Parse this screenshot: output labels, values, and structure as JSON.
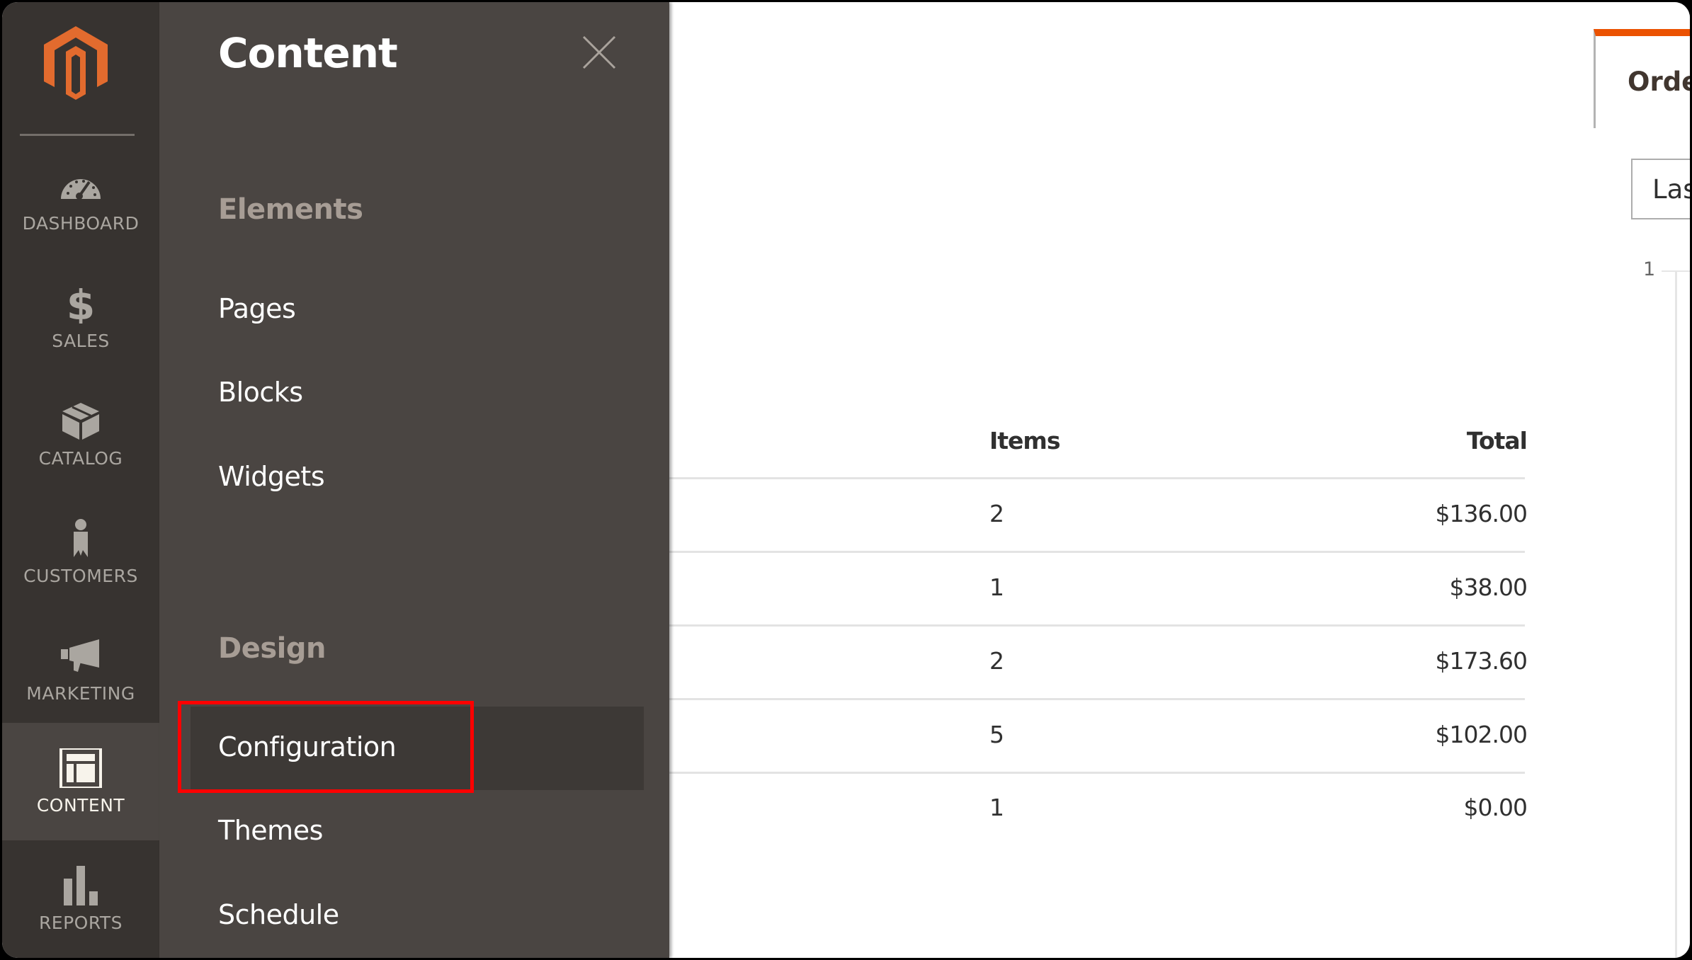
{
  "colors": {
    "brand_orange": "#eb5202",
    "nav_bg": "#373330",
    "flyout_bg": "#4a4542",
    "highlight_outline": "#ff0000"
  },
  "logo": {
    "icon": "magento-logo-icon"
  },
  "nav": {
    "items": [
      {
        "label": "DASHBOARD",
        "icon": "dashboard-gauge-icon",
        "active": false
      },
      {
        "label": "SALES",
        "icon": "dollar-icon",
        "active": false
      },
      {
        "label": "CATALOG",
        "icon": "box-icon",
        "active": false
      },
      {
        "label": "CUSTOMERS",
        "icon": "person-icon",
        "active": false
      },
      {
        "label": "MARKETING",
        "icon": "megaphone-icon",
        "active": false
      },
      {
        "label": "CONTENT",
        "icon": "layout-icon",
        "active": true
      },
      {
        "label": "REPORTS",
        "icon": "bar-chart-icon",
        "active": false
      }
    ]
  },
  "flyout": {
    "title": "Content",
    "close_icon": "close-icon",
    "sections": [
      {
        "heading": "Elements",
        "links": [
          "Pages",
          "Blocks",
          "Widgets"
        ]
      },
      {
        "heading": "Design",
        "links": [
          "Configuration",
          "Themes",
          "Schedule"
        ]
      }
    ],
    "highlighted_link": "Configuration"
  },
  "main": {
    "tab_label": "Orde",
    "period_select_value": "Las",
    "chart_tick": "1",
    "table": {
      "headers": {
        "items": "Items",
        "total": "Total"
      },
      "rows": [
        {
          "items": "2",
          "total": "$136.00"
        },
        {
          "items": "1",
          "total": "$38.00"
        },
        {
          "items": "2",
          "total": "$173.60"
        },
        {
          "items": "5",
          "total": "$102.00"
        },
        {
          "items": "1",
          "total": "$0.00"
        }
      ]
    }
  }
}
